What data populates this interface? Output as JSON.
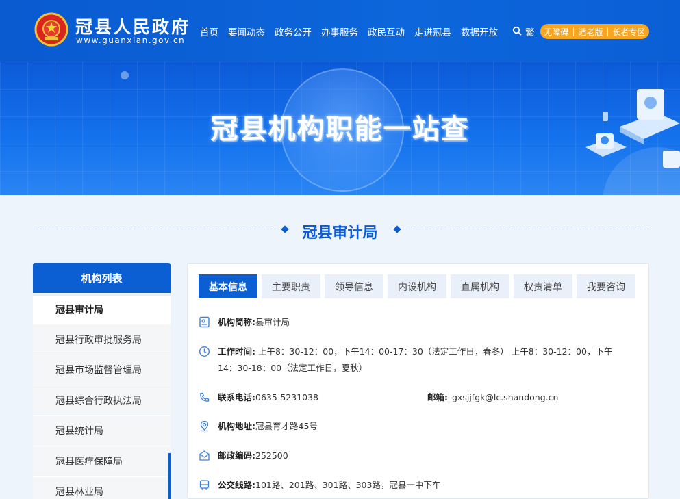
{
  "header": {
    "site_title": "冠县人民政府",
    "site_url": "www.guanxian.gov.cn",
    "nav": [
      "首页",
      "要闻动态",
      "政务公开",
      "办事服务",
      "政民互动",
      "走进冠县",
      "数据开放"
    ],
    "lang_toggle": "繁",
    "accessibility": [
      "无障碍",
      "适老版",
      "长者专区"
    ],
    "colors": {
      "primary": "#0c5fd3",
      "accent": "#f6a623"
    }
  },
  "banner": {
    "title": "冠县机构职能一站查"
  },
  "section": {
    "title": "冠县审计局"
  },
  "sidebar": {
    "title": "机构列表",
    "items": [
      "冠县审计局",
      "冠县行政审批服务局",
      "冠县市场监督管理局",
      "冠县综合行政执法局",
      "冠县统计局",
      "冠县医疗保障局",
      "冠县林业局"
    ],
    "active_index": 0
  },
  "tabs": [
    "基本信息",
    "主要职责",
    "领导信息",
    "内设机构",
    "直属机构",
    "权责清单",
    "我要咨询"
  ],
  "active_tab": 0,
  "info": {
    "short_name": {
      "label": "机构简称:",
      "value": "县审计局"
    },
    "hours": {
      "label": "工作时间:",
      "value": "上午8：30-12：00，下午14：00-17：30（法定工作日，春冬） 上午8：30-12：00，下午14：30-18：00（法定工作日，夏秋）"
    },
    "phone": {
      "label": "联系电话:",
      "value": "0635-5231038"
    },
    "email": {
      "label": "邮箱:",
      "value": "gxsjjfgk@lc.shandong.cn"
    },
    "address": {
      "label": "机构地址:",
      "value": "冠县育才路45号"
    },
    "postcode": {
      "label": "邮政编码:",
      "value": "252500"
    },
    "bus": {
      "label": "公交线路:",
      "value": "101路、201路、301路、303路，冠县一中下车"
    }
  },
  "icons": [
    "national-emblem-icon",
    "search-icon",
    "id-card-icon",
    "clock-icon",
    "phone-icon",
    "location-icon",
    "mail-icon",
    "bus-icon"
  ]
}
